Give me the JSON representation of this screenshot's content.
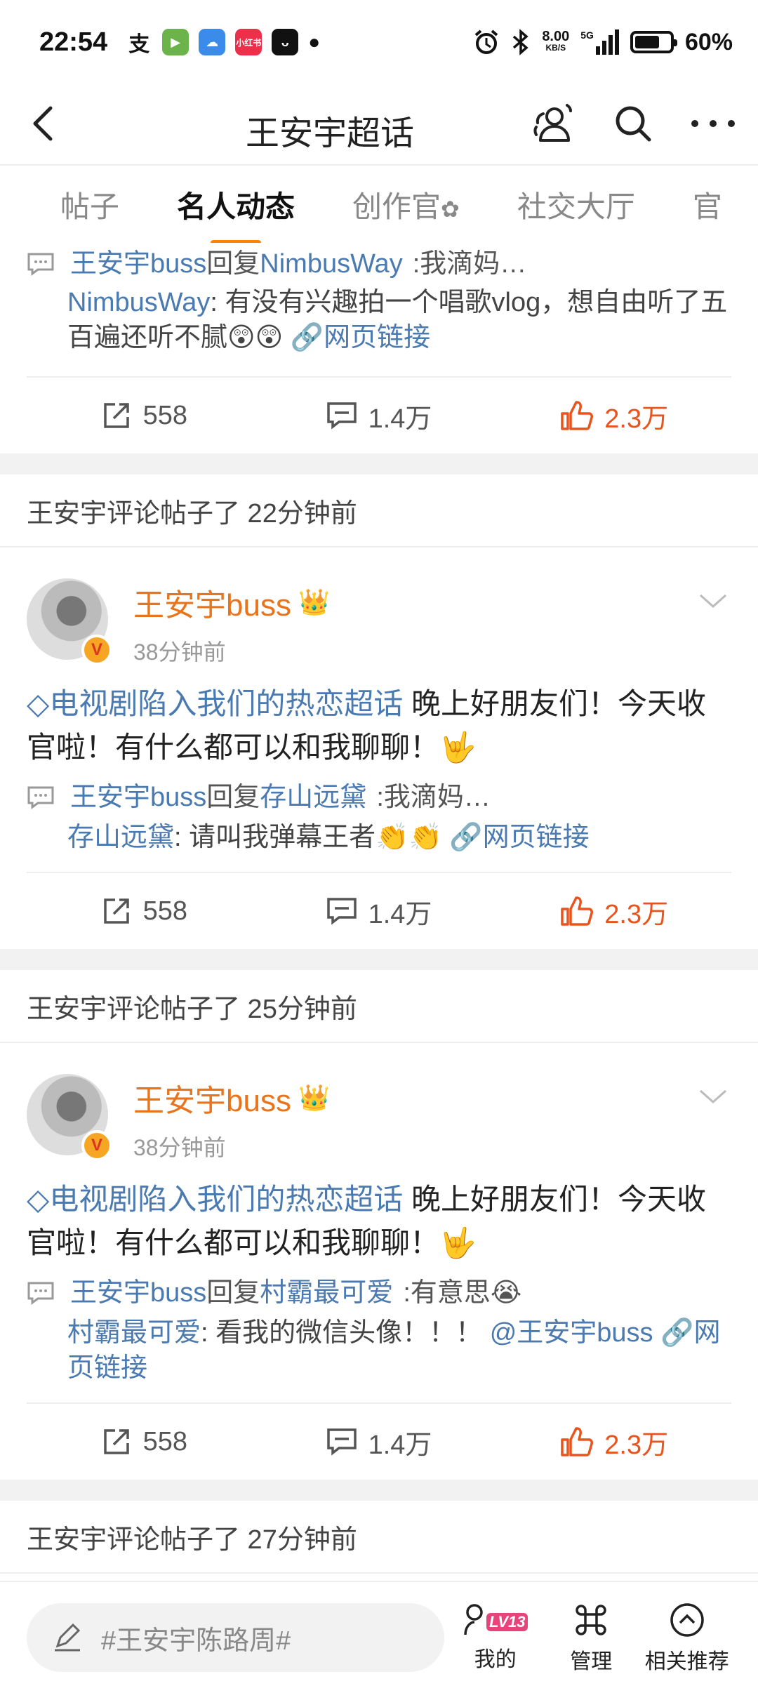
{
  "status_bar": {
    "time": "22:54",
    "network_speed": "8.00",
    "network_unit": "KB/S",
    "network_type": "5G",
    "battery": "60%",
    "notif_icons": [
      "alipay-icon",
      "game-icon",
      "cloud-icon",
      "xiaohongshu-icon",
      "app-icon"
    ]
  },
  "nav": {
    "title": "王安宇超话"
  },
  "tabs": [
    {
      "label": "帖子",
      "active": false
    },
    {
      "label": "名人动态",
      "active": true
    },
    {
      "label": "创作官",
      "active": false
    },
    {
      "label": "社交大厅",
      "active": false
    },
    {
      "label": "官",
      "active": false
    }
  ],
  "feed": {
    "top_reply": {
      "author": "王安宇buss",
      "verb": "回复",
      "target": "NimbusWay",
      "text": ":我滴妈…",
      "quote_author": "NimbusWay",
      "quote_text": ": 有没有兴趣拍一个唱歌vlog，想自由听了五百遍还听不腻😲😲",
      "link": "网页链接",
      "actions": {
        "share": "558",
        "comment": "1.4万",
        "like": "2.3万"
      }
    },
    "sections": [
      {
        "header": "王安宇评论帖子了 22分钟前",
        "author": "王安宇buss",
        "time": "38分钟前",
        "topic": "电视剧陷入我们的热恋超话",
        "text": "  晚上好朋友们！今天收官啦！有什么都可以和我聊聊！🤟",
        "reply": {
          "author": "王安宇buss",
          "verb": "回复",
          "target": "存山远黛",
          "text": ":我滴妈…"
        },
        "quote_author": "存山远黛",
        "quote_text": ": 请叫我弹幕王者👏👏",
        "mention": "",
        "link": "网页链接",
        "actions": {
          "share": "558",
          "comment": "1.4万",
          "like": "2.3万"
        }
      },
      {
        "header": "王安宇评论帖子了 25分钟前",
        "author": "王安宇buss",
        "time": "38分钟前",
        "topic": "电视剧陷入我们的热恋超话",
        "text": "  晚上好朋友们！今天收官啦！有什么都可以和我聊聊！🤟",
        "reply": {
          "author": "王安宇buss",
          "verb": "回复",
          "target": "村霸最可爱",
          "text": ":有意思😭"
        },
        "quote_author": "村霸最可爱",
        "quote_text": ": 看我的微信头像！！！",
        "mention": "@王安宇buss",
        "link": "网页链接",
        "actions": {
          "share": "558",
          "comment": "1.4万",
          "like": "2.3万"
        }
      }
    ],
    "partial_header": "王安宇评论帖子了 27分钟前"
  },
  "bottom_bar": {
    "search_placeholder": "#王安宇陈路周#",
    "level_badge": "LV13",
    "items": [
      {
        "label": "我的",
        "icon": "profile-icon"
      },
      {
        "label": "管理",
        "icon": "command-icon"
      },
      {
        "label": "相关推荐",
        "icon": "chevron-up-circle-icon"
      }
    ]
  },
  "colors": {
    "accent": "#ff8200",
    "link": "#4a7ab0",
    "like": "#e8541c",
    "author": "#e8741c"
  }
}
